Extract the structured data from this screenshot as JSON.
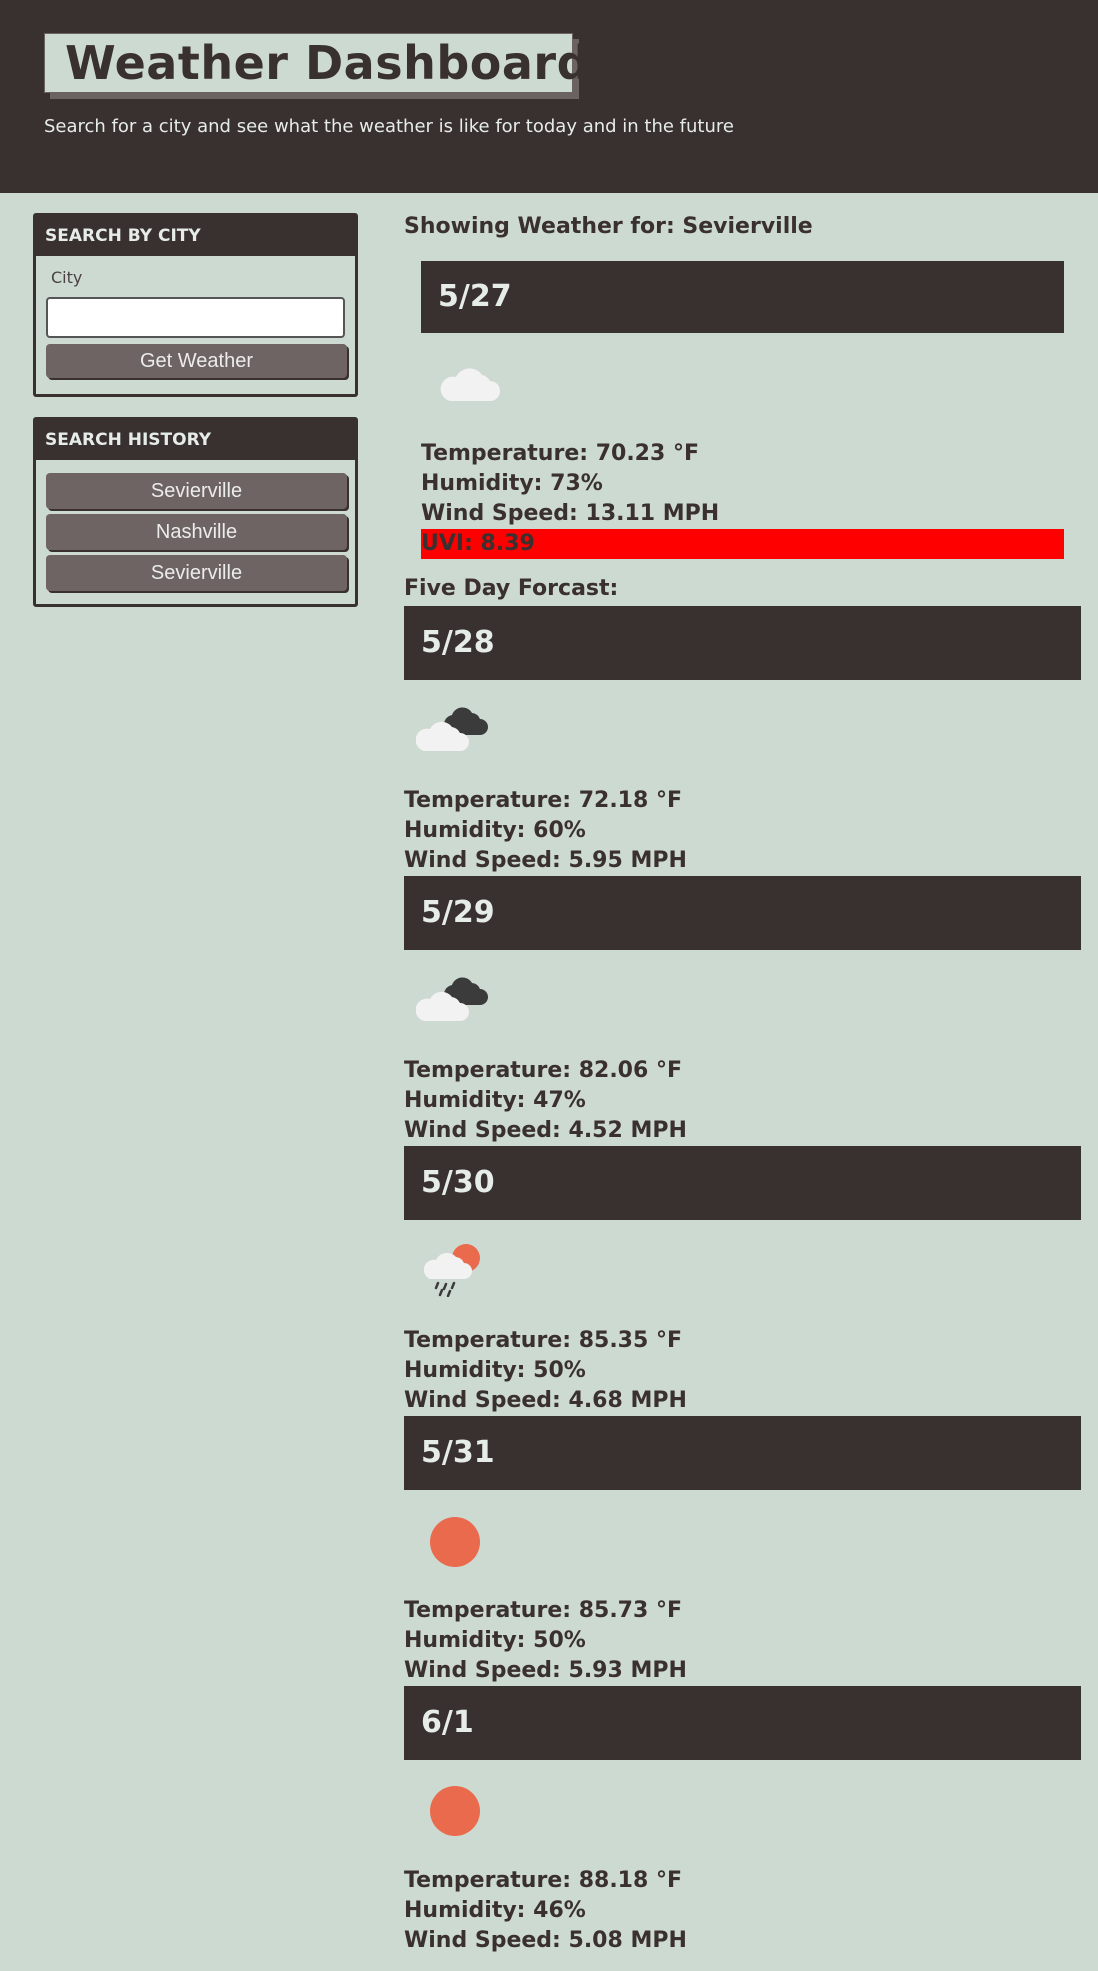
{
  "header": {
    "title": "Weather Dashboard",
    "subtitle": "Search for a city and see what the weather is like for today and in the future"
  },
  "search": {
    "heading": "SEARCH BY CITY",
    "city_label": "City",
    "input_value": "",
    "button_label": "Get Weather"
  },
  "history": {
    "heading": "SEARCH HISTORY",
    "items": [
      "Sevierville",
      "Nashville",
      "Sevierville"
    ]
  },
  "current": {
    "showing_label": "Showing Weather for: Sevierville",
    "date": "5/27",
    "icon": "cloud-icon",
    "temperature": "Temperature: 70.23 °F",
    "humidity": "Humidity: 73%",
    "wind": "Wind Speed: 13.11 MPH",
    "uvi": "UVI: 8.39",
    "uvi_color": "#ff0000"
  },
  "forecast": {
    "heading": "Five Day Forcast:",
    "days": [
      {
        "date": "5/28",
        "icon": "broken-clouds-icon",
        "temperature": "Temperature: 72.18 °F",
        "humidity": "Humidity: 60%",
        "wind": "Wind Speed: 5.95 MPH"
      },
      {
        "date": "5/29",
        "icon": "broken-clouds-icon",
        "temperature": "Temperature: 82.06 °F",
        "humidity": "Humidity: 47%",
        "wind": "Wind Speed: 4.52 MPH"
      },
      {
        "date": "5/30",
        "icon": "sun-rain-icon",
        "temperature": "Temperature: 85.35 °F",
        "humidity": "Humidity: 50%",
        "wind": "Wind Speed: 4.68 MPH"
      },
      {
        "date": "5/31",
        "icon": "sun-icon",
        "temperature": "Temperature: 85.73 °F",
        "humidity": "Humidity: 50%",
        "wind": "Wind Speed: 5.93 MPH"
      },
      {
        "date": "6/1",
        "icon": "sun-icon",
        "temperature": "Temperature: 88.18 °F",
        "humidity": "Humidity: 46%",
        "wind": "Wind Speed: 5.08 MPH"
      }
    ]
  },
  "colors": {
    "background": "#cddad1",
    "dark": "#393030",
    "button": "#6e6464",
    "sun": "#ea6a4d"
  }
}
